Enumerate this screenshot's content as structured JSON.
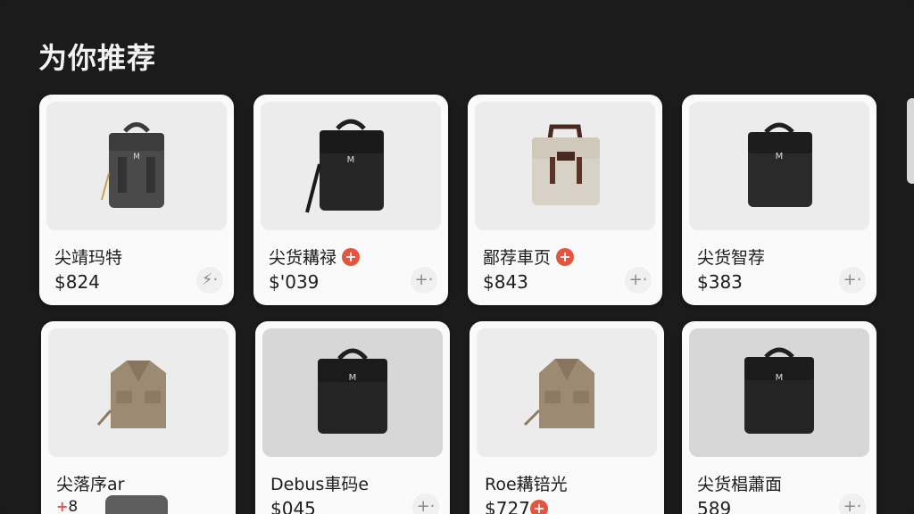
{
  "header": {
    "title": "为你推荐"
  },
  "products": [
    {
      "name": "尖靖玛特",
      "price": "$824",
      "badge": "",
      "action_icon": "⚡·"
    },
    {
      "name": "尖货耩禄",
      "price": "$'039",
      "badge": "+",
      "action_icon": "+·"
    },
    {
      "name": "鄙荐車页",
      "price": "$843",
      "badge": "+",
      "action_icon": "+·"
    },
    {
      "name": "尖货智荐",
      "price": "$383",
      "badge": "",
      "action_icon": "+·"
    },
    {
      "name": "尖落序ar",
      "price": "8",
      "price_prefix": "+",
      "badge": "",
      "action_icon": ""
    },
    {
      "name": "Debus車码e",
      "price": "$045",
      "badge": "",
      "action_icon": "+·"
    },
    {
      "name": "Roe耩锫光",
      "price": "$727",
      "badge": "+",
      "action_icon": ""
    },
    {
      "name": "尖货椙蕭面",
      "price": "589",
      "badge": "",
      "action_icon": "+·"
    }
  ],
  "colors": {
    "accent": "#e4553f",
    "background": "#1b1b1b",
    "card": "#fafafa"
  },
  "icons": {
    "add": "plus-icon",
    "badge": "plus-badge-icon"
  }
}
